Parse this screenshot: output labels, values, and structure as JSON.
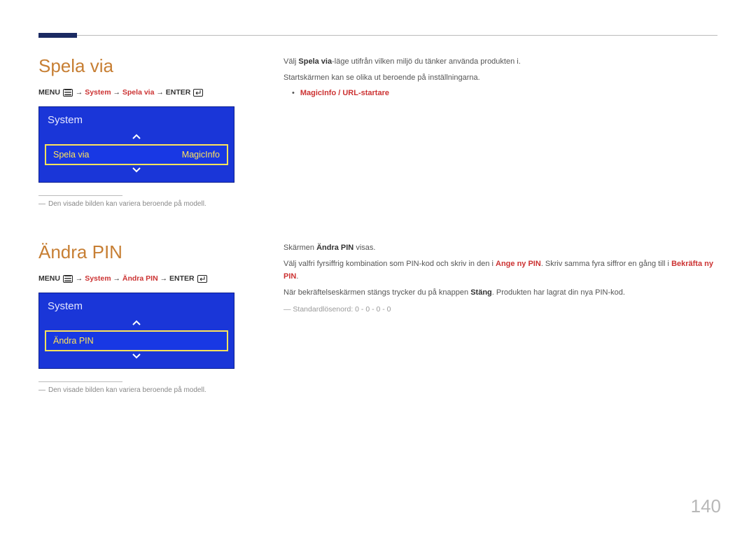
{
  "page_number": "140",
  "section1": {
    "heading": "Spela via",
    "path": {
      "prefix": "MENU",
      "menu_icon": "menu-icon",
      "nav_red": "System",
      "nav2_red": "Spela via",
      "suffix": "ENTER",
      "enter_icon": "enter-icon",
      "arrow": "→"
    },
    "menu": {
      "title": "System",
      "item_label": "Spela via",
      "item_value": "MagicInfo"
    },
    "footnote": "Den visade bilden kan variera beroende på modell.",
    "right": {
      "p1_pre": "Välj ",
      "p1_bold": "Spela via",
      "p1_post": "-läge utifrån vilken miljö du tänker använda produkten i.",
      "p2": "Startskärmen kan se olika ut beroende på inställningarna.",
      "bullet": "MagicInfo / URL-startare"
    }
  },
  "section2": {
    "heading": "Ändra PIN",
    "path": {
      "prefix": "MENU",
      "nav_red": "System",
      "nav2_red": "Ändra PIN",
      "suffix": "ENTER",
      "arrow": "→"
    },
    "menu": {
      "title": "System",
      "item_label": "Ändra PIN"
    },
    "footnote": "Den visade bilden kan variera beroende på modell.",
    "right": {
      "p1_pre": "Skärmen ",
      "p1_bold": "Ändra PIN",
      "p1_post": " visas.",
      "p2_pre": "Välj valfri fyrsiffrig kombination som PIN-kod och skriv in den i ",
      "p2_red1": "Ange ny PIN",
      "p2_mid": ". Skriv samma fyra siffror en gång till i ",
      "p2_red2": "Bekräfta ny PIN",
      "p2_post": ".",
      "p3_pre": "När bekräftelseskärmen stängs trycker du på knappen ",
      "p3_bold": "Stäng",
      "p3_post": ". Produkten har lagrat din nya PIN-kod.",
      "footnote": "Standardlösenord: 0 - 0 - 0 - 0"
    }
  }
}
